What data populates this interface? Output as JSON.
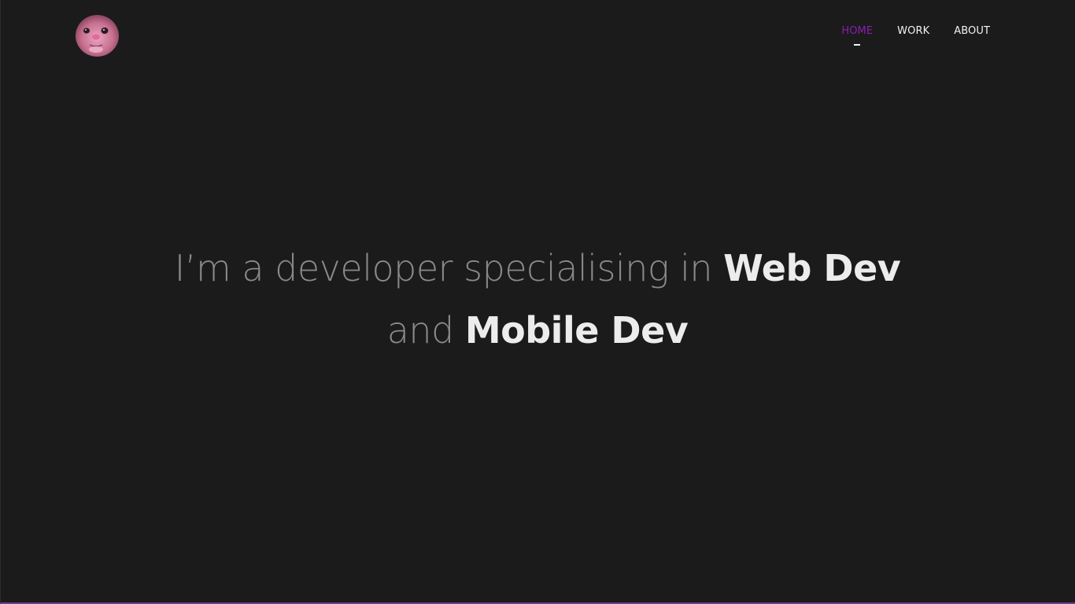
{
  "avatar": {
    "alt": "profile avatar"
  },
  "nav": {
    "items": [
      {
        "label": "HOME",
        "active": true
      },
      {
        "label": "WORK",
        "active": false
      },
      {
        "label": "ABOUT",
        "active": false
      }
    ],
    "active_color": "#8a1fb0",
    "text_color": "#f2f2f2"
  },
  "hero": {
    "part1": "I’m a developer specialising in ",
    "skill1": "Web Dev",
    "part2": " and ",
    "skill2": "Mobile Dev"
  },
  "colors": {
    "background": "#1b1b1c",
    "light_text": "#8a8a8a",
    "bold_text": "#ececec",
    "bottom_line": "#6b3f8f"
  }
}
